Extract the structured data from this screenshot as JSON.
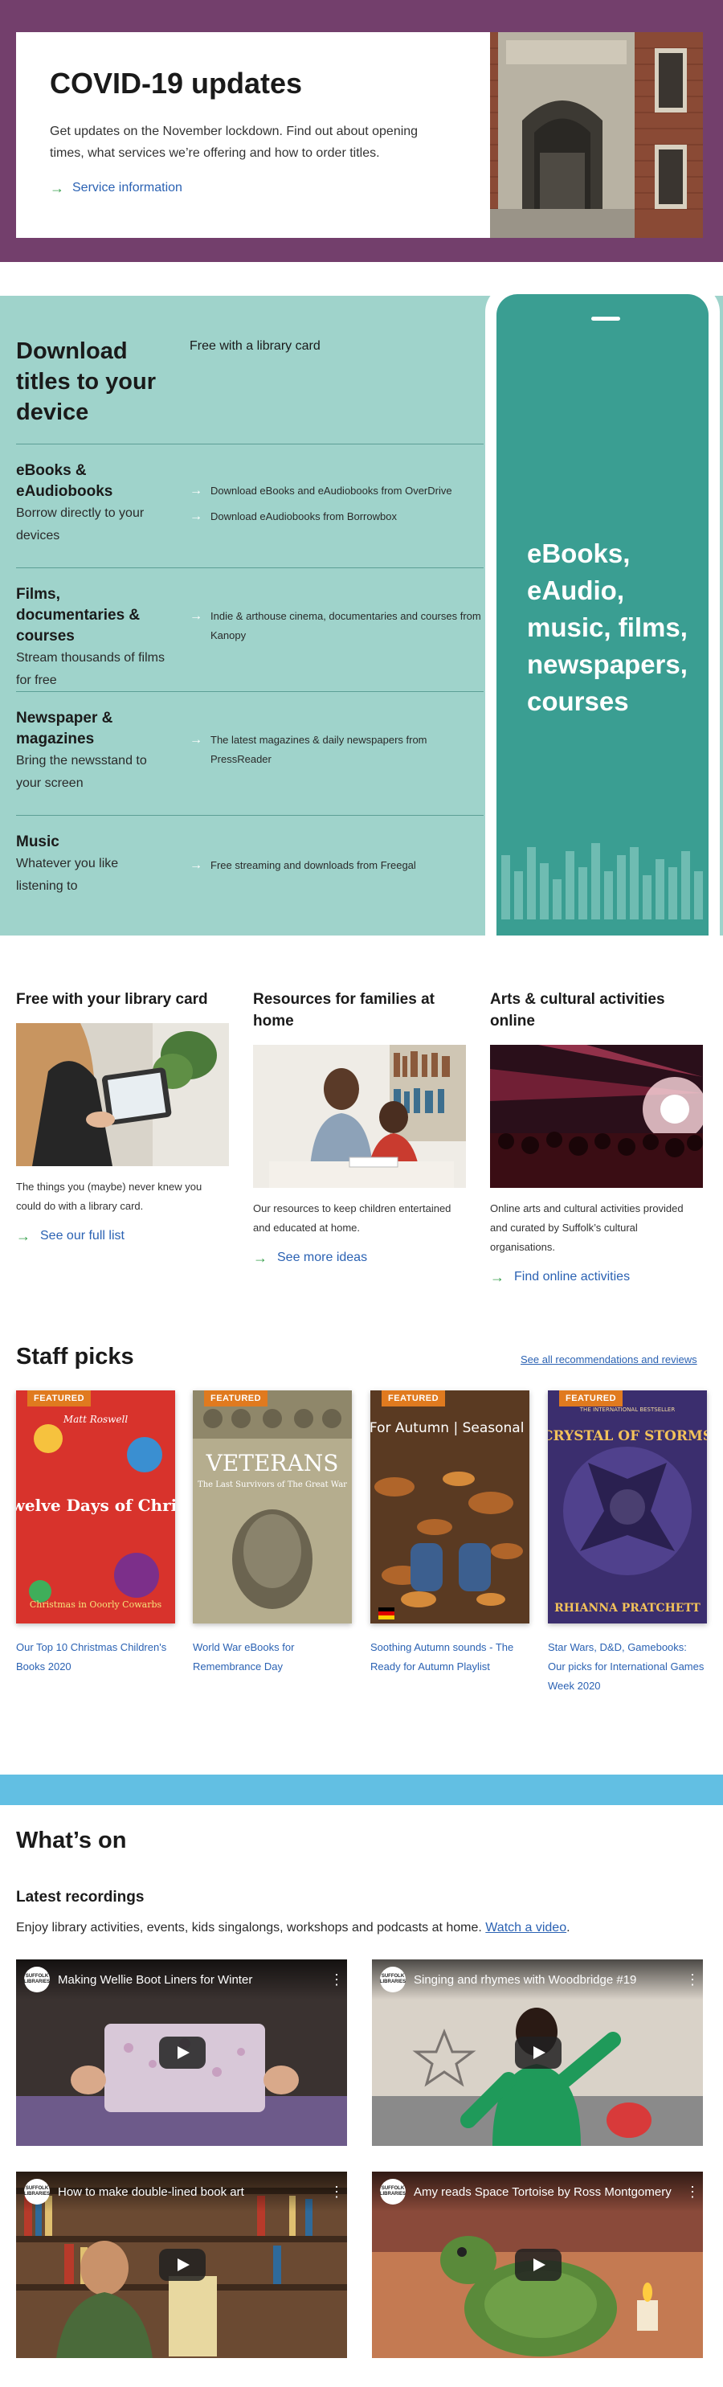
{
  "covid": {
    "title": "COVID-19 updates",
    "text": "Get updates on the November lockdown. Find out about opening times, what services we’re offering and how to order titles.",
    "link": "Service information"
  },
  "download": {
    "title": "Download titles to your device",
    "free": "Free with a library card",
    "rows": [
      {
        "title": "eBooks & eAudiobooks",
        "desc": "Borrow directly to your devices",
        "links": [
          "Download eBooks and eAudiobooks from OverDrive",
          "Download eAudiobooks from Borrowbox"
        ]
      },
      {
        "title": "Films, documentaries & courses",
        "desc": "Stream thousands of films for free",
        "links": [
          "Indie & arthouse cinema, documentaries and courses from Kanopy"
        ]
      },
      {
        "title": "Newspaper & magazines",
        "desc": "Bring the newsstand to your screen",
        "links": [
          "The latest magazines & daily newspapers from PressReader"
        ]
      },
      {
        "title": "Music",
        "desc": "Whatever you like listening to",
        "links": [
          "Free streaming and downloads from Freegal"
        ]
      }
    ],
    "phone_text": "eBooks, eAudio, music, films, newspapers, courses"
  },
  "columns": [
    {
      "title": "Free with your library card",
      "text": "The things you (maybe) never knew you could do with a library card.",
      "link": "See our full list"
    },
    {
      "title": "Resources for families at home",
      "text": "Our resources to keep children entertained and educated at home.",
      "link": "See more ideas"
    },
    {
      "title": "Arts & cultural activities online",
      "text": "Online arts and cultural activities provided and curated by Suffolk’s cultural organisations.",
      "link": "Find online activities"
    }
  ],
  "picks": {
    "title": "Staff picks",
    "all_link": "See all recommendations and reviews",
    "featured_label": "FEATURED",
    "books": [
      {
        "title": "Our Top 10 Christmas Children's Books 2020",
        "cover_top": "Matt Roswell",
        "cover_main": "The Twelve Days of Christmas",
        "cover_sub": "Christmas in Ooorly Cowarbs"
      },
      {
        "title": "World War eBooks for Remembrance Day",
        "cover_main": "VETERANS",
        "cover_sub": "The Last Survivors of The Great War"
      },
      {
        "title": "Soothing Autumn sounds - The Ready for Autumn Playlist",
        "cover_main": "Ready For Autumn | Seasonal Playlist"
      },
      {
        "title": "Star Wars, D&D, Gamebooks: Our picks for International Games Week 2020",
        "cover_top": "THE INTERNATIONAL BESTSELLER",
        "cover_main": "CRYSTAL OF STORMS",
        "cover_author": "RHIANNA PRATCHETT"
      }
    ]
  },
  "whats_on": {
    "title": "What’s on",
    "latest_title": "Latest recordings",
    "latest_desc": "Enjoy library activities, events, kids singalongs, workshops and podcasts at home.",
    "watch_link": "Watch a video",
    "channel": "SUFFOLK LIBRARIES",
    "videos": [
      {
        "title": "Making Wellie Boot Liners for Winter"
      },
      {
        "title": "Singing and rhymes with Woodbridge #19"
      },
      {
        "title": "How to make double-lined book art"
      },
      {
        "title": "Amy reads Space Tortoise by Ross Montgomery"
      }
    ]
  },
  "colors": {
    "covid_bg": "#733f6c",
    "download_bg": "#9fd3cb",
    "phone": "#3a9e92",
    "link": "#2b62b3",
    "arrow": "#3aa14f",
    "featured": "#e07a1f",
    "divider": "#62bfe3"
  }
}
